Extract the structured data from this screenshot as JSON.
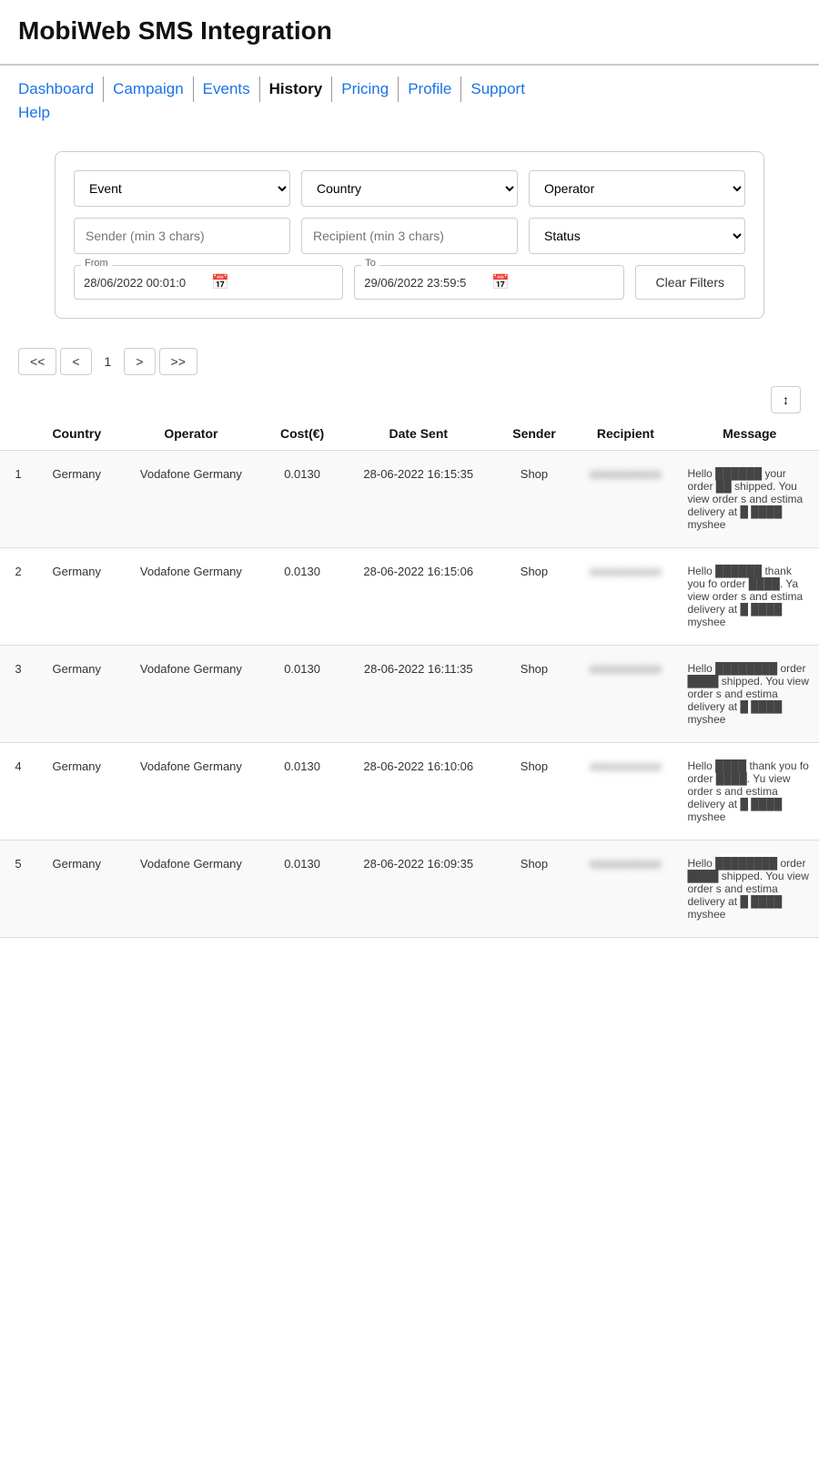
{
  "app": {
    "title": "MobiWeb SMS Integration"
  },
  "nav": {
    "items": [
      {
        "label": "Dashboard",
        "active": false
      },
      {
        "label": "Campaign",
        "active": false
      },
      {
        "label": "Events",
        "active": false
      },
      {
        "label": "History",
        "active": true
      },
      {
        "label": "Pricing",
        "active": false
      },
      {
        "label": "Profile",
        "active": false
      },
      {
        "label": "Support",
        "active": false
      }
    ],
    "second_row": [
      {
        "label": "Help",
        "active": false
      }
    ]
  },
  "filters": {
    "event_placeholder": "Event",
    "country_placeholder": "Country",
    "operator_placeholder": "Operator",
    "sender_placeholder": "Sender (min 3 chars)",
    "recipient_placeholder": "Recipient (min 3 chars)",
    "status_placeholder": "Status",
    "from_label": "From",
    "from_value": "28/06/2022 00:01:0",
    "to_label": "To",
    "to_value": "29/06/2022 23:59:5",
    "clear_filters_label": "Clear Filters"
  },
  "pagination": {
    "first_label": "<<",
    "prev_label": "<",
    "page": "1",
    "next_label": ">",
    "last_label": ">>"
  },
  "table": {
    "columns": [
      "",
      "Country",
      "Operator",
      "Cost(€)",
      "Date Sent",
      "Sender",
      "Recipient",
      "Message"
    ],
    "rows": [
      {
        "num": "1",
        "country": "Germany",
        "operator": "Vodafone Germany",
        "cost": "0.0130",
        "date_sent": "28-06-2022 16:15:35",
        "sender": "Shop",
        "recipient": "●●●●●●●●●●",
        "message": "Hello ██████ your order ██ shipped. You view order s and estima delivery at █ ████ myshee"
      },
      {
        "num": "2",
        "country": "Germany",
        "operator": "Vodafone Germany",
        "cost": "0.0130",
        "date_sent": "28-06-2022 16:15:06",
        "sender": "Shop",
        "recipient": "●●●●●●●●●●",
        "message": "Hello ██████ thank you fo order ████. Ya view order s and estima delivery at █ ████ myshee"
      },
      {
        "num": "3",
        "country": "Germany",
        "operator": "Vodafone Germany",
        "cost": "0.0130",
        "date_sent": "28-06-2022 16:11:35",
        "sender": "Shop",
        "recipient": "●●●●●●●●●●",
        "message": "Hello ████████ order ████ shipped. You view order s and estima delivery at █ ████ myshee"
      },
      {
        "num": "4",
        "country": "Germany",
        "operator": "Vodafone Germany",
        "cost": "0.0130",
        "date_sent": "28-06-2022 16:10:06",
        "sender": "Shop",
        "recipient": "●●●●●●●●●●",
        "message": "Hello ████ thank you fo order ████. Yu view order s and estima delivery at █ ████ myshee"
      },
      {
        "num": "5",
        "country": "Germany",
        "operator": "Vodafone Germany",
        "cost": "0.0130",
        "date_sent": "28-06-2022 16:09:35",
        "sender": "Shop",
        "recipient": "●●●●●●●●●●",
        "message": "Hello ████████ order ████ shipped. You view order s and estima delivery at █ ████ myshee"
      }
    ]
  }
}
